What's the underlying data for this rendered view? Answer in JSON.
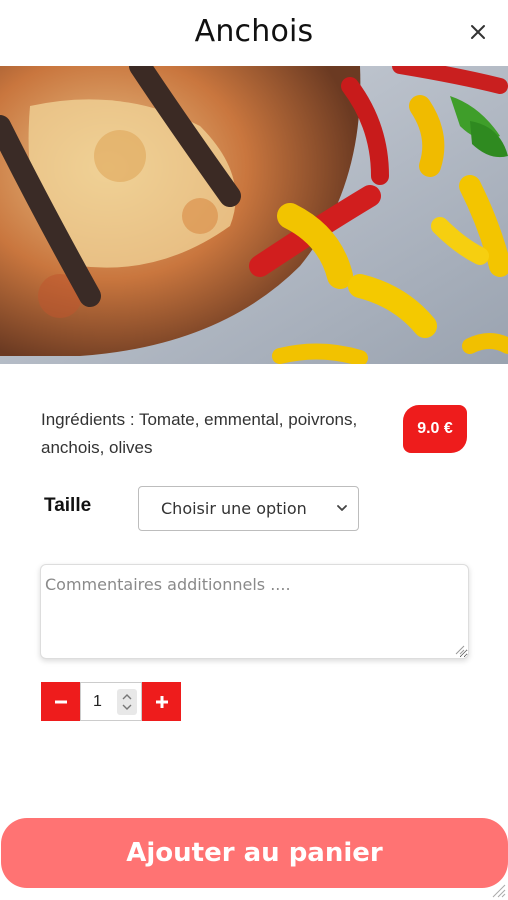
{
  "header": {
    "title": "Anchois",
    "close_icon": "close-icon"
  },
  "product": {
    "image_alt": "anchovy-pizza-photo",
    "ingredients": "Ingrédients : Tomate, emmental, poivrons, anchois, olives",
    "price": "9.0 €"
  },
  "options": {
    "taille_label": "Taille",
    "taille_selected": "Choisir une option"
  },
  "comment": {
    "placeholder": "Commentaires additionnels ...."
  },
  "quantity": {
    "value": "1",
    "minus_icon": "minus-icon",
    "plus_icon": "plus-icon"
  },
  "cart": {
    "add_label": "Ajouter au panier"
  },
  "colors": {
    "accent": "#ee1c1c",
    "add_button": "#ff7373",
    "text": "#222222"
  }
}
